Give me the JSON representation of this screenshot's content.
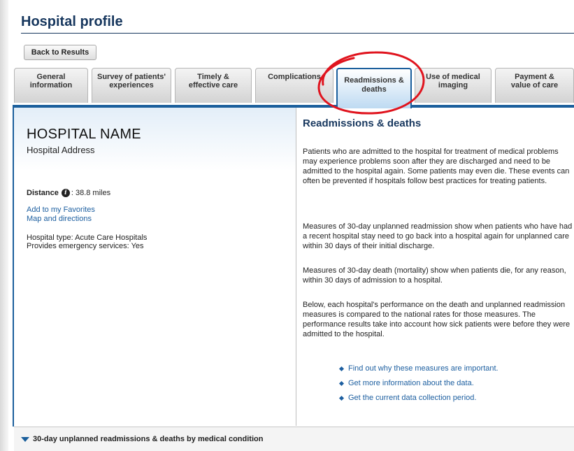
{
  "header": {
    "title": "Hospital profile",
    "back_label": "Back to Results"
  },
  "tabs": [
    {
      "label": "General information"
    },
    {
      "label": "Survey of patients' experiences"
    },
    {
      "label": "Timely & effective care"
    },
    {
      "label": "Complications"
    },
    {
      "label": "Readmissions & deaths",
      "active": true
    },
    {
      "label": "Use of medical imaging"
    },
    {
      "label": "Payment & value of care"
    }
  ],
  "hospital": {
    "name": "HOSPITAL NAME",
    "address": "Hospital Address",
    "distance_label": "Distance",
    "distance_value": ": 38.8 miles",
    "favorites_link": "Add to my Favorites",
    "map_link": "Map and directions",
    "type": "Hospital type: Acute Care Hospitals",
    "emergency": "Provides emergency services: Yes"
  },
  "main": {
    "title": "Readmissions & deaths",
    "paragraphs": [
      "Patients who are admitted to the hospital for treatment of medical problems may experience problems soon after they are discharged and need to be admitted to the hospital again. Some patients may even die. These events can often be prevented if hospitals follow best practices for treating patients.",
      "Measures of 30-day unplanned readmission show when patients who have had a recent hospital stay need to go back into a hospital again for unplanned care within 30 days of their initial discharge.",
      "Measures of 30-day death (mortality) show when patients die, for any reason, within 30 days of admission to a hospital.",
      "Below, each hospital's performance on the death and unplanned readmission measures is compared to the national rates for those measures. The performance results take into account how sick patients were before they were admitted to the hospital."
    ],
    "links": [
      "Find out why these measures are important.",
      "Get more information about the data.",
      "Get the current data collection period."
    ]
  },
  "footer": {
    "section_label": "30-day unplanned readmissions & deaths by medical condition"
  },
  "colors": {
    "title": "#17375e",
    "accent": "#1b5f9c",
    "link": "#1d5fa0",
    "annotation": "#e0141e"
  }
}
